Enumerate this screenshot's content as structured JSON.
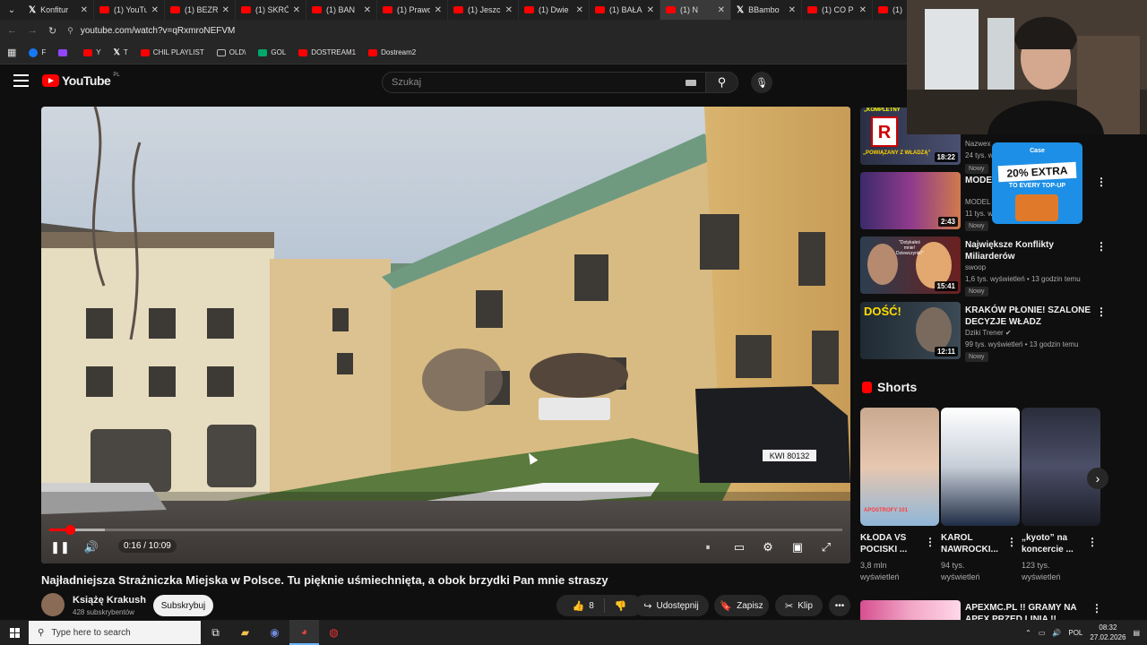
{
  "tabs": [
    {
      "title": "Konfitur",
      "favicon": "x-icon",
      "active": false
    },
    {
      "title": "(1) YouTu",
      "favicon": "youtube-icon",
      "active": false
    },
    {
      "title": "(1) BEZR",
      "favicon": "youtube-icon",
      "active": false
    },
    {
      "title": "(1) SKRÓ",
      "favicon": "youtube-icon",
      "active": false
    },
    {
      "title": "(1) BAN",
      "favicon": "youtube-icon",
      "active": false
    },
    {
      "title": "(1) Prawd",
      "favicon": "youtube-icon",
      "active": false
    },
    {
      "title": "(1) Jeszc",
      "favicon": "youtube-icon",
      "active": false
    },
    {
      "title": "(1) Dwie",
      "favicon": "youtube-icon",
      "active": false
    },
    {
      "title": "(1) BAŁA",
      "favicon": "youtube-icon",
      "active": false
    },
    {
      "title": "(1) N",
      "favicon": "youtube-icon",
      "active": true
    },
    {
      "title": "BBambo",
      "favicon": "x-icon",
      "active": false
    },
    {
      "title": "(1) CO P",
      "favicon": "youtube-icon",
      "active": false
    },
    {
      "title": "(1)",
      "favicon": "youtube-icon",
      "active": false
    }
  ],
  "address": {
    "url": "youtube.com/watch?v=qRxmroNEFVM"
  },
  "bookmarks": [
    {
      "label": "F",
      "icon": "facebook-icon"
    },
    {
      "label": "",
      "icon": "twitch-icon"
    },
    {
      "label": "Y",
      "icon": "youtube-icon"
    },
    {
      "label": "T",
      "icon": "x-icon"
    },
    {
      "label": "CHIL PLAYLIST",
      "icon": "youtube-icon"
    },
    {
      "label": "OLD\\",
      "icon": "folder-icon"
    },
    {
      "label": "GOL",
      "icon": "gol-icon"
    },
    {
      "label": "DOSTREAM1",
      "icon": "youtube-icon"
    },
    {
      "label": "Dostream2",
      "icon": "youtube-icon"
    }
  ],
  "youtube": {
    "logo": "YouTube",
    "country": "PL",
    "search_placeholder": "Szukaj"
  },
  "player": {
    "time": "0:16 / 10:09",
    "played_fraction": 0.026,
    "loaded_fraction": 0.07,
    "plate": "KWI 80132"
  },
  "video": {
    "title": "Najładniejsza Strażniczka Miejska w Polsce. Tu pięknie uśmiechnięta, a obok brzydki Pan mnie straszy",
    "channel": "Książę Krakush",
    "subscribers": "428 subskrybentów",
    "subscribe_label": "Subskrybuj",
    "likes": "8",
    "share_label": "Udostępnij",
    "save_label": "Zapisz",
    "clip_label": "Klip"
  },
  "recommendations": [
    {
      "title": "",
      "channel": "Nazwex",
      "meta": "24 tys. w",
      "badge": "Nowy",
      "duration": "18:22",
      "thumb_text": "„POWIĄZANY Z WŁADZĄ”",
      "thumb_top": "„KOMPLETNY"
    },
    {
      "title": "MODEL WIEDZI",
      "channel": "MODEL",
      "meta": "11 tys. w",
      "badge": "Nowy",
      "duration": "2:43"
    },
    {
      "title": "Największe Konflikty Miliarderów",
      "channel": "swoop",
      "meta": "1,6 tys. wyświetleń • 13 godzin temu",
      "badge": "Nowy",
      "duration": "15:41",
      "thumb_text": "\"Dotykałeś mnie! Dziewczynki!\""
    },
    {
      "title": "KRAKÓW PŁONIE! SZALONE DECYZJE WŁADZ",
      "channel": "Dziki Trener",
      "meta": "99 tys. wyświetleń • 13 godzin temu",
      "badge": "Nowy",
      "duration": "12:11",
      "thumb_text": "DOŚĆ!"
    }
  ],
  "shorts": {
    "heading": "Shorts",
    "items": [
      {
        "title": "KŁODA VS POCISKI ...",
        "views": "3,8 mln wyświetleń",
        "thumb_text": "APOSTROFY 101"
      },
      {
        "title": "KAROL NAWROCKI...",
        "views": "94 tys. wyświetleń"
      },
      {
        "title": "„kyoto” na koncercie ...",
        "views": "123 tys. wyświetleń"
      }
    ]
  },
  "last_recommendation": {
    "title": "APEXMC.PL !! GRAMY NA APEX PRZED LINIA !! APEXMC.PL"
  },
  "promo": {
    "brand": "Case",
    "headline": "20% EXTRA",
    "subline": "TO EVERY TOP-UP"
  },
  "taskbar": {
    "search_placeholder": "Type here to search",
    "language": "POL",
    "time": "08:32",
    "date": "27.02.2026"
  }
}
